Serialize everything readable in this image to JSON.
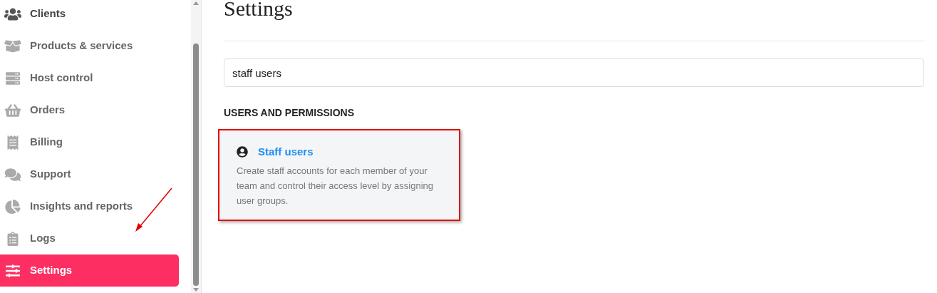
{
  "sidebar": {
    "items": [
      {
        "label": "Clients",
        "selected": false
      },
      {
        "label": "Products & services",
        "selected": false
      },
      {
        "label": "Host control",
        "selected": false
      },
      {
        "label": "Orders",
        "selected": false
      },
      {
        "label": "Billing",
        "selected": false
      },
      {
        "label": "Support",
        "selected": false
      },
      {
        "label": "Insights and reports",
        "selected": false
      },
      {
        "label": "Logs",
        "selected": false
      },
      {
        "label": "Settings",
        "selected": true
      }
    ]
  },
  "page": {
    "title": "Settings",
    "search": {
      "value": "staff users"
    },
    "sections": [
      {
        "heading": "USERS AND PERMISSIONS",
        "cards": [
          {
            "title": "Staff users",
            "description": "Create staff accounts for each member of your team and control their access level by assigning user groups.",
            "highlighted": true
          }
        ]
      }
    ]
  }
}
